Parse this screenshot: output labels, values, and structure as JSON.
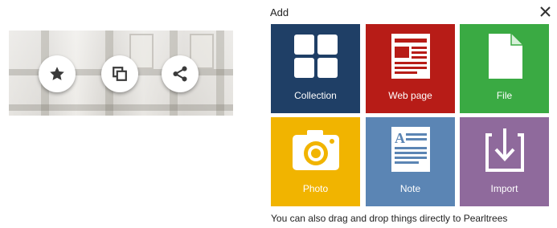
{
  "panel": {
    "title": "Add",
    "close_icon": "close-icon",
    "tiles": [
      {
        "id": "collection",
        "label": "Collection",
        "color": "#1f3f66",
        "icon": "grid-icon"
      },
      {
        "id": "webpage",
        "label": "Web page",
        "color": "#b71c17",
        "icon": "web-page-icon"
      },
      {
        "id": "file",
        "label": "File",
        "color": "#3aaa43",
        "icon": "file-icon"
      },
      {
        "id": "photo",
        "label": "Photo",
        "color": "#f1b400",
        "icon": "camera-icon"
      },
      {
        "id": "note",
        "label": "Note",
        "color": "#5b85b4",
        "icon": "note-icon"
      },
      {
        "id": "import",
        "label": "Import",
        "color": "#8f6a9c",
        "icon": "import-icon"
      }
    ],
    "footer": "You can also drag and drop things directly to Pearltrees"
  },
  "thumbnail": {
    "actions": [
      {
        "icon": "star-icon"
      },
      {
        "icon": "copy-icon"
      },
      {
        "icon": "share-icon"
      }
    ]
  }
}
